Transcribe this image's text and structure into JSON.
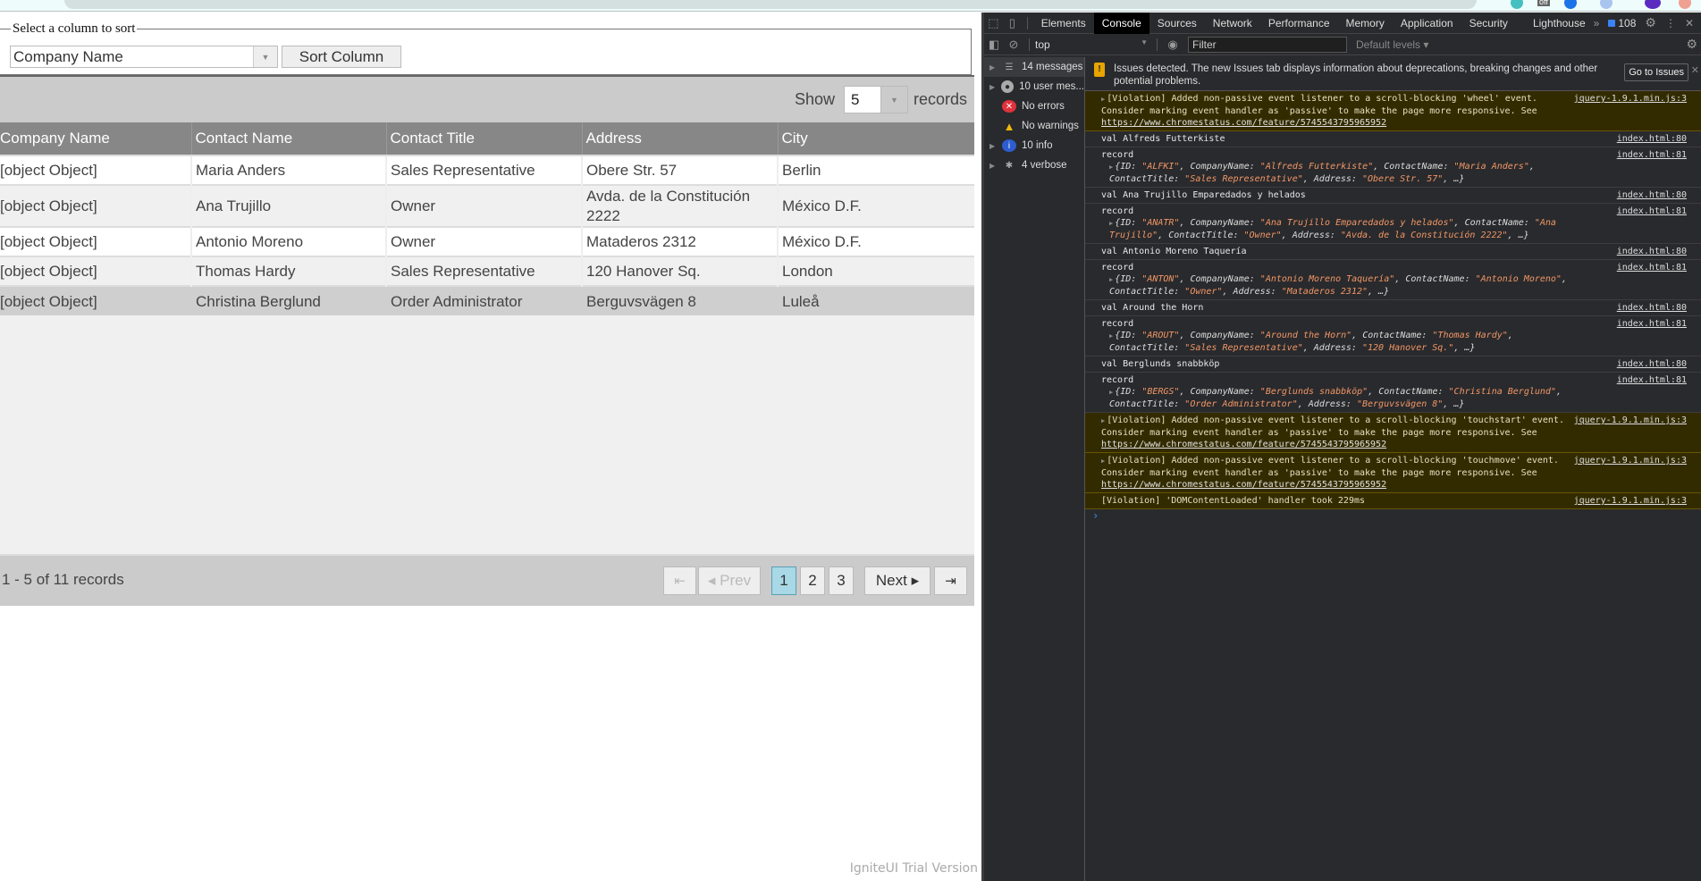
{
  "browser": {
    "extension_badge": "off"
  },
  "sort_panel": {
    "legend": "Select a column to sort",
    "column_select_value": "Company Name",
    "sort_button": "Sort Column"
  },
  "grid": {
    "page_size_label_before": "Show",
    "page_size_value": "5",
    "page_size_label_after": "records",
    "columns": [
      "Company Name",
      "Contact Name",
      "Contact Title",
      "Address",
      "City"
    ],
    "rows": [
      [
        "[object Object]",
        "Maria Anders",
        "Sales Representative",
        "Obere Str. 57",
        "Berlin"
      ],
      [
        "[object Object]",
        "Ana Trujillo",
        "Owner",
        "Avda. de la Constitución 2222",
        "México D.F."
      ],
      [
        "[object Object]",
        "Antonio Moreno",
        "Owner",
        "Mataderos 2312",
        "México D.F."
      ],
      [
        "[object Object]",
        "Thomas Hardy",
        "Sales Representative",
        "120 Hanover Sq.",
        "London"
      ],
      [
        "[object Object]",
        "Christina Berglund",
        "Order Administrator",
        "Berguvsvägen 8",
        "Luleå"
      ]
    ],
    "pager": {
      "summary": "1 - 5 of 11 records",
      "first_icon": "⇤",
      "prev": "◂ Prev",
      "pages": [
        "1",
        "2",
        "3"
      ],
      "current_page": "1",
      "next": "Next ▸",
      "last_icon": "⇥"
    },
    "watermark": "IgniteUI Trial Version"
  },
  "devtools": {
    "tabs": [
      "Elements",
      "Console",
      "Sources",
      "Network",
      "Performance",
      "Memory",
      "Application",
      "Security",
      "Lighthouse"
    ],
    "active_tab": "Console",
    "more_tabs": "»",
    "message_count": "108",
    "context": "top",
    "filter_placeholder": "Filter",
    "levels": "Default levels ▾",
    "sidebar": [
      {
        "label": "14 messages",
        "icon": "list-icon"
      },
      {
        "label": "10 user mes...",
        "icon": "user-icon"
      },
      {
        "label": "No errors",
        "icon": "error-icon"
      },
      {
        "label": "No warnings",
        "icon": "warning-icon"
      },
      {
        "label": "10 info",
        "icon": "info-icon"
      },
      {
        "label": "4 verbose",
        "icon": "bug-icon"
      }
    ],
    "issues_banner": {
      "text": "Issues detected. The new Issues tab displays information about deprecations, breaking changes and other potential problems.",
      "button": "Go to Issues"
    },
    "messages": [
      {
        "type": "violation",
        "text": "[Violation] Added non-passive event listener to a scroll-blocking 'wheel' event. Consider marking event handler as 'passive' to make the page more responsive. See ",
        "link": "https://www.chromestatus.com/feature/5745543795965952",
        "source": "jquery-1.9.1.min.js:3"
      },
      {
        "type": "log",
        "text": "val Alfreds Futterkiste",
        "source": "index.html:80"
      },
      {
        "type": "record",
        "text": "record",
        "obj": "{ID: \"ALFKI\", CompanyName: \"Alfreds Futterkiste\", ContactName: \"Maria Anders\", ContactTitle: \"Sales Representative\", Address: \"Obere Str. 57\", …}",
        "source": "index.html:81"
      },
      {
        "type": "log",
        "text": "val Ana Trujillo Emparedados y helados",
        "source": "index.html:80"
      },
      {
        "type": "record",
        "text": "record",
        "obj": "{ID: \"ANATR\", CompanyName: \"Ana Trujillo Emparedados y helados\", ContactName: \"Ana Trujillo\", ContactTitle: \"Owner\", Address: \"Avda. de la Constitución 2222\", …}",
        "source": "index.html:81"
      },
      {
        "type": "log",
        "text": "val Antonio Moreno Taquería",
        "source": "index.html:80"
      },
      {
        "type": "record",
        "text": "record",
        "obj": "{ID: \"ANTON\", CompanyName: \"Antonio Moreno Taquería\", ContactName: \"Antonio Moreno\", ContactTitle: \"Owner\", Address: \"Mataderos  2312\", …}",
        "source": "index.html:81"
      },
      {
        "type": "log",
        "text": "val Around the Horn",
        "source": "index.html:80"
      },
      {
        "type": "record",
        "text": "record",
        "obj": "{ID: \"AROUT\", CompanyName: \"Around the Horn\", ContactName: \"Thomas Hardy\", ContactTitle: \"Sales Representative\", Address: \"120 Hanover Sq.\", …}",
        "source": "index.html:81"
      },
      {
        "type": "log",
        "text": "val Berglunds snabbköp",
        "source": "index.html:80"
      },
      {
        "type": "record",
        "text": "record",
        "obj": "{ID: \"BERGS\", CompanyName: \"Berglunds snabbköp\", ContactName: \"Christina Berglund\", ContactTitle: \"Order Administrator\", Address: \"Berguvsvägen  8\", …}",
        "source": "index.html:81"
      },
      {
        "type": "violation",
        "text": "[Violation] Added non-passive event listener to a scroll-blocking 'touchstart' event. Consider marking event handler as 'passive' to make the page more responsive. See ",
        "link": "https://www.chromestatus.com/feature/5745543795965952",
        "source": "jquery-1.9.1.min.js:3"
      },
      {
        "type": "violation",
        "text": "[Violation] Added non-passive event listener to a scroll-blocking 'touchmove' event. Consider marking event handler as 'passive' to make the page more responsive. See ",
        "link": "https://www.chromestatus.com/feature/5745543795965952",
        "source": "jquery-1.9.1.min.js:3"
      },
      {
        "type": "violation-plain",
        "text": "[Violation] 'DOMContentLoaded' handler took 229ms",
        "source": "jquery-1.9.1.min.js:3"
      }
    ]
  }
}
